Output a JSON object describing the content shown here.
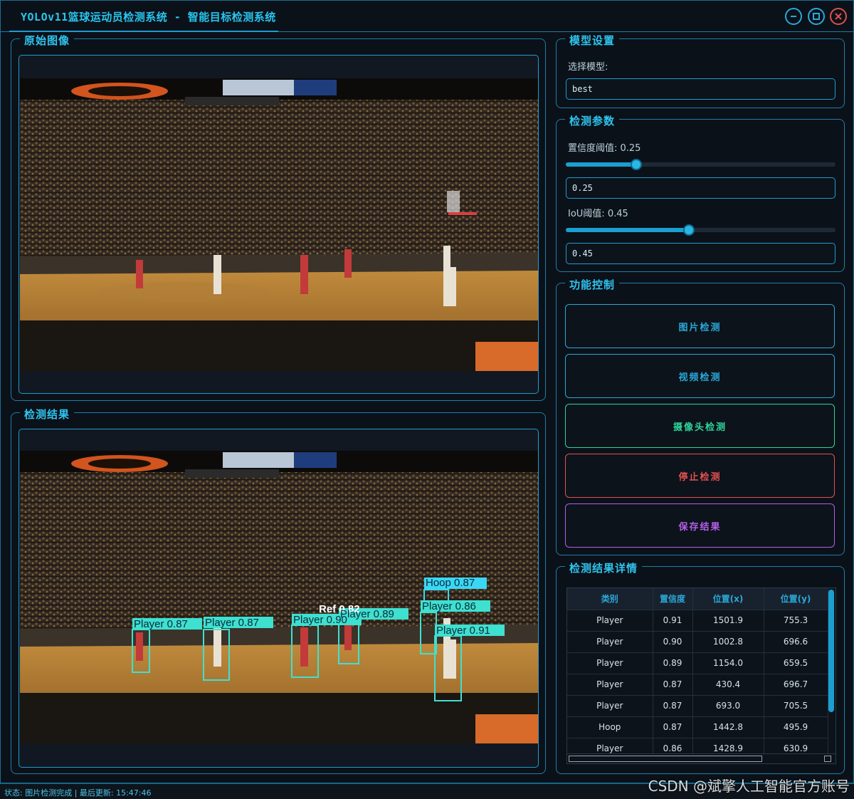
{
  "window": {
    "title": "YOLOv11篮球运动员检测系统 - 智能目标检测系统",
    "minimize_icon": "minimize-icon",
    "maximize_icon": "maximize-icon",
    "close_icon": "close-icon",
    "accent_color": "#27c6ef",
    "danger_color": "#e04e4e"
  },
  "original_panel": {
    "title": "原始图像"
  },
  "result_panel": {
    "title": "检测结果"
  },
  "detections_overlay": [
    {
      "label": "Player 0.87",
      "color": "#3ee0d0"
    },
    {
      "label": "Player 0.87",
      "color": "#3ee0d0"
    },
    {
      "label": "Player 0.90",
      "color": "#3ee0d0"
    },
    {
      "label": "Ref 0.82",
      "color": "#ffffff"
    },
    {
      "label": "Player 0.89",
      "color": "#3ee0d0"
    },
    {
      "label": "Hoop 0.87",
      "color": "#3ad7f5"
    },
    {
      "label": "Player 0.86",
      "color": "#3ee0d0"
    },
    {
      "label": "Player 0.91",
      "color": "#3ee0d0"
    }
  ],
  "model_settings": {
    "title": "模型设置",
    "select_label": "选择模型:",
    "selected_model": "best"
  },
  "params": {
    "title": "检测参数",
    "conf_label": "置信度阈值: 0.25",
    "conf_value": "0.25",
    "conf_fraction": 0.25,
    "iou_label": "IoU阈值: 0.45",
    "iou_value": "0.45",
    "iou_fraction": 0.45
  },
  "controls": {
    "title": "功能控制",
    "image_detect": "图片检测",
    "video_detect": "视频检测",
    "camera_detect": "摄像头检测",
    "stop_detect": "停止检测",
    "save_result": "保存结果",
    "colors": {
      "image": "#2aa8d8",
      "video": "#2aa8d8",
      "camera": "#2fd59a",
      "stop": "#e55050",
      "save": "#b45ee8"
    }
  },
  "details": {
    "title": "检测结果详情",
    "columns": [
      "类别",
      "置信度",
      "位置(x)",
      "位置(y)"
    ],
    "rows": [
      [
        "Player",
        "0.91",
        "1501.9",
        "755.3"
      ],
      [
        "Player",
        "0.90",
        "1002.8",
        "696.6"
      ],
      [
        "Player",
        "0.89",
        "1154.0",
        "659.5"
      ],
      [
        "Player",
        "0.87",
        "430.4",
        "696.7"
      ],
      [
        "Player",
        "0.87",
        "693.0",
        "705.5"
      ],
      [
        "Hoop",
        "0.87",
        "1442.8",
        "495.9"
      ],
      [
        "Player",
        "0.86",
        "1428.9",
        "630.9"
      ]
    ]
  },
  "status": {
    "text": "状态: 图片检测完成 | 最后更新: 15:47:46"
  },
  "watermark": "CSDN @斌擎人工智能官方账号"
}
